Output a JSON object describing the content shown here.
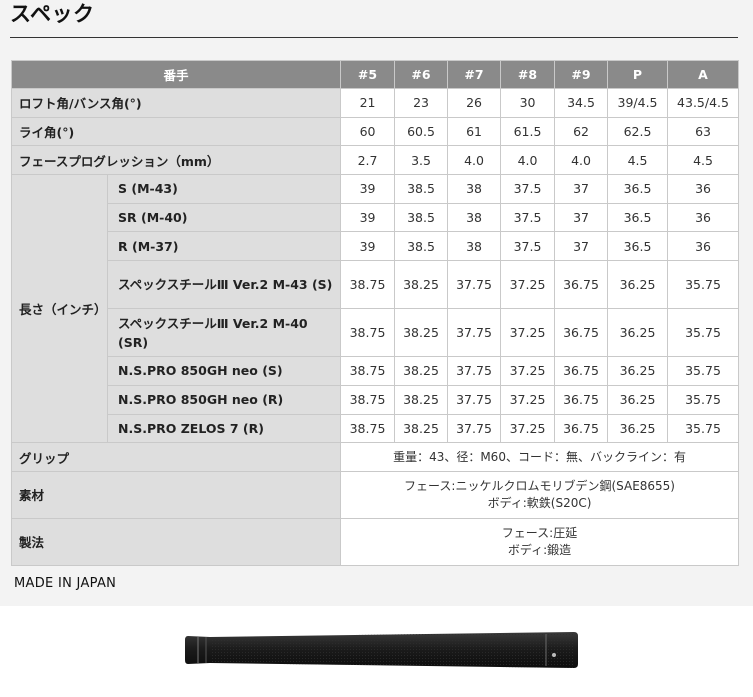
{
  "title": "スペック",
  "header": {
    "label": "番手",
    "clubs": [
      "#5",
      "#6",
      "#7",
      "#8",
      "#9",
      "P",
      "A"
    ]
  },
  "rows": {
    "loft": {
      "label": "ロフト角/バンス角(°)",
      "values": [
        "21",
        "23",
        "26",
        "30",
        "34.5",
        "39/4.5",
        "43.5/4.5"
      ]
    },
    "lie": {
      "label": "ライ角(°)",
      "values": [
        "60",
        "60.5",
        "61",
        "61.5",
        "62",
        "62.5",
        "63"
      ]
    },
    "progression": {
      "label": "フェースプログレッション（mm）",
      "values": [
        "2.7",
        "3.5",
        "4.0",
        "4.0",
        "4.0",
        "4.5",
        "4.5"
      ]
    }
  },
  "length": {
    "label": "長さ（インチ）",
    "shafts": [
      {
        "name": "S (M-43)",
        "values": [
          "39",
          "38.5",
          "38",
          "37.5",
          "37",
          "36.5",
          "36"
        ]
      },
      {
        "name": "SR (M-40)",
        "values": [
          "39",
          "38.5",
          "38",
          "37.5",
          "37",
          "36.5",
          "36"
        ]
      },
      {
        "name": "R (M-37)",
        "values": [
          "39",
          "38.5",
          "38",
          "37.5",
          "37",
          "36.5",
          "36"
        ]
      },
      {
        "name": "スペックスチールⅢ Ver.2 M-43 (S)",
        "values": [
          "38.75",
          "38.25",
          "37.75",
          "37.25",
          "36.75",
          "36.25",
          "35.75"
        ]
      },
      {
        "name": "スペックスチールⅢ Ver.2 M-40 (SR)",
        "values": [
          "38.75",
          "38.25",
          "37.75",
          "37.25",
          "36.75",
          "36.25",
          "35.75"
        ]
      },
      {
        "name": "N.S.PRO 850GH neo (S)",
        "values": [
          "38.75",
          "38.25",
          "37.75",
          "37.25",
          "36.75",
          "36.25",
          "35.75"
        ]
      },
      {
        "name": "N.S.PRO 850GH neo (R)",
        "values": [
          "38.75",
          "38.25",
          "37.75",
          "37.25",
          "36.75",
          "36.25",
          "35.75"
        ]
      },
      {
        "name": "N.S.PRO ZELOS 7 (R)",
        "values": [
          "38.75",
          "38.25",
          "37.75",
          "37.25",
          "36.75",
          "36.25",
          "35.75"
        ]
      }
    ]
  },
  "grip": {
    "label": "グリップ",
    "value": "重量：43、径：M60、コード：無、バックライン：有"
  },
  "material": {
    "label": "素材",
    "line1": "フェース:ニッケルクロムモリブデン鋼(SAE8655)",
    "line2": "ボディ:軟鉄(S20C)"
  },
  "process": {
    "label": "製法",
    "line1": "フェース:圧延",
    "line2": "ボディ:鍛造"
  },
  "origin": "MADE IN JAPAN",
  "colors": {
    "header_bg": "#8a8a8a",
    "label_bg": "#dedede",
    "panel_bg": "#f3f3f3",
    "grip_color": "#1a1a1a"
  }
}
